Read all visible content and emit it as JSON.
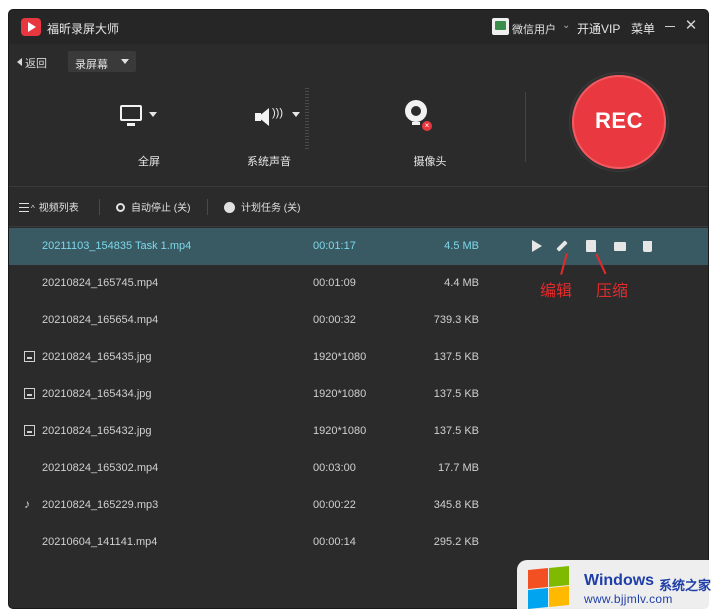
{
  "titlebar": {
    "app_title": "福昕录屏大师",
    "user_name": "微信用户",
    "vip_label": "开通VIP",
    "menu_label": "菜单",
    "minimize": "—",
    "close": "✕"
  },
  "nav": {
    "back_label": "返回",
    "mode_select": "录屏幕"
  },
  "sources": {
    "screen_label": "全屏",
    "audio_label": "系统声音",
    "camera_label": "摄像头"
  },
  "rec_button": {
    "label": "REC",
    "color": "#e9383f"
  },
  "toolbar": {
    "video_list": "视频列表",
    "auto_stop": "自动停止 (关)",
    "schedule": "计划任务 (关)"
  },
  "files": [
    {
      "type": "video",
      "name": "20211103_154835 Task 1.mp4",
      "info": "00:01:17",
      "size": "4.5 MB",
      "selected": true
    },
    {
      "type": "video",
      "name": "20210824_165745.mp4",
      "info": "00:01:09",
      "size": "4.4 MB"
    },
    {
      "type": "video",
      "name": "20210824_165654.mp4",
      "info": "00:00:32",
      "size": "739.3 KB"
    },
    {
      "type": "image",
      "name": "20210824_165435.jpg",
      "info": "1920*1080",
      "size": "137.5 KB"
    },
    {
      "type": "image",
      "name": "20210824_165434.jpg",
      "info": "1920*1080",
      "size": "137.5 KB"
    },
    {
      "type": "image",
      "name": "20210824_165432.jpg",
      "info": "1920*1080",
      "size": "137.5 KB"
    },
    {
      "type": "video",
      "name": "20210824_165302.mp4",
      "info": "00:03:00",
      "size": "17.7 MB"
    },
    {
      "type": "audio",
      "name": "20210824_165229.mp3",
      "info": "00:00:22",
      "size": "345.8 KB"
    },
    {
      "type": "video",
      "name": "20210604_141141.mp4",
      "info": "00:00:14",
      "size": "295.2 KB"
    }
  ],
  "row_actions": [
    "play-icon",
    "edit-icon",
    "compress-icon",
    "folder-icon",
    "trash-icon"
  ],
  "annotations": {
    "edit": "编辑",
    "compress": "压缩"
  },
  "watermark": {
    "brand": "Windows",
    "suffix": "系统之家",
    "url": "www.bjjmlv.com"
  },
  "colors": {
    "window_bg": "#2b2b2c",
    "selected_row_bg": "#3a5a63",
    "selected_text": "#7dd8ea",
    "annotation": "#e32b2b"
  }
}
